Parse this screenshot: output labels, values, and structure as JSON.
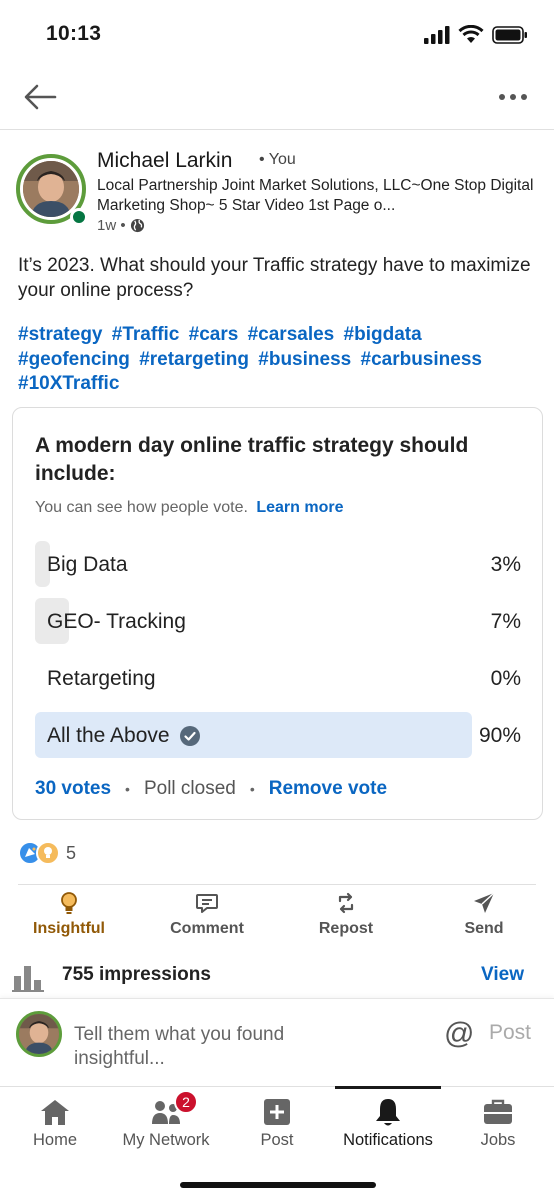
{
  "status": {
    "time": "10:13"
  },
  "author": {
    "name": "Michael Larkin",
    "you_label": "• You",
    "headline": "Local Partnership Joint Market Solutions, LLC~One Stop Digital Marketing Shop~ 5 Star Video 1st Page o...",
    "time_ago": "1w •"
  },
  "post": {
    "text": "It’s 2023.  What should your Traffic strategy have to maximize your online process?",
    "hashtags": [
      "#strategy",
      "#Traffic",
      "#cars",
      "#carsales",
      "#bigdata",
      "#geofencing",
      "#retargeting",
      "#business",
      "#carbusiness",
      "#10XTraffic"
    ]
  },
  "poll": {
    "question": "A modern day online traffic strategy should include:",
    "note": "You can see how people vote.",
    "learn_more": "Learn more",
    "options": [
      {
        "label": "Big Data",
        "percent": "3%",
        "value": 3,
        "selected": false
      },
      {
        "label": "GEO- Tracking",
        "percent": "7%",
        "value": 7,
        "selected": false
      },
      {
        "label": "Retargeting",
        "percent": "0%",
        "value": 0,
        "selected": false
      },
      {
        "label": "All the Above",
        "percent": "90%",
        "value": 90,
        "selected": true
      }
    ],
    "votes": "30 votes",
    "status": "Poll closed",
    "remove_vote": "Remove vote"
  },
  "reactions": {
    "count": "5"
  },
  "actions": {
    "insightful": "Insightful",
    "comment": "Comment",
    "repost": "Repost",
    "send": "Send"
  },
  "impressions": {
    "text": "755 impressions",
    "view": "View"
  },
  "comment_box": {
    "placeholder": "Tell them what you found insightful...",
    "post": "Post"
  },
  "tabs": {
    "home": "Home",
    "network": "My Network",
    "network_badge": "2",
    "post": "Post",
    "notifications": "Notifications",
    "jobs": "Jobs"
  },
  "colors": {
    "accent": "#0a66c2",
    "insightful": "#915907",
    "ring": "#5d9c3b",
    "badge": "#cb112d"
  }
}
